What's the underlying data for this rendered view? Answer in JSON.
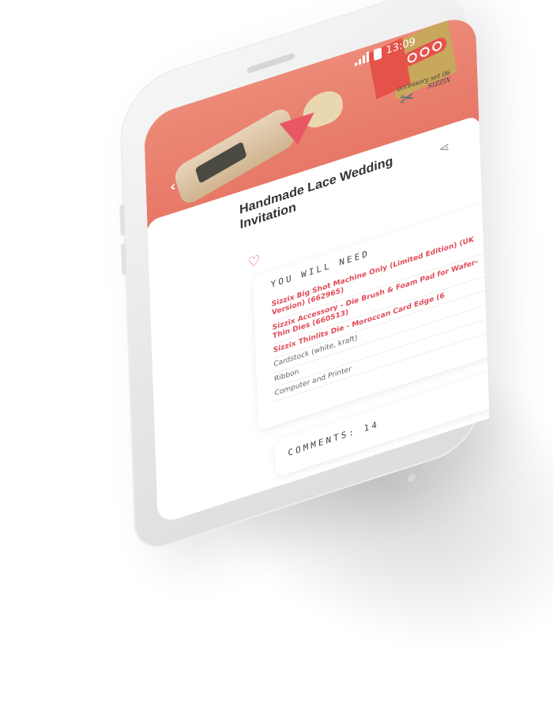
{
  "status_bar": {
    "time": "13:09"
  },
  "hero": {
    "caption_line1": "accessory set 06",
    "caption_line2": "SIZZIX"
  },
  "recipe": {
    "title": "Handmade Lace Wedding Invitation"
  },
  "you_will_need": {
    "heading": "YOU WILL NEED",
    "items": [
      {
        "label": "Sizzix Big Shot Machine Only (Limited Edition) (UK Version) (662965)",
        "type": "link"
      },
      {
        "label": "Sizzix Accessory - Die Brush & Foam Pad for Wafer-Thin Dies (660513)",
        "type": "link"
      },
      {
        "label": "Sizzix Thinlits Die - Moroccan Card Edge (6",
        "type": "link"
      },
      {
        "label": "Cardstock (white, kraft)",
        "type": "plain"
      },
      {
        "label": "Ribbon",
        "type": "plain"
      },
      {
        "label": "Computer and Printer",
        "type": "plain"
      }
    ]
  },
  "comments": {
    "label": "COMMENTS: 14"
  },
  "colors": {
    "hero": "#e77766",
    "accent": "#e14b57",
    "play": "#ea5764"
  },
  "icons": {
    "back": "chevron-left-icon",
    "play": "play-icon",
    "share": "share-icon",
    "heart": "heart-icon",
    "signal": "signal-icon",
    "battery": "battery-icon"
  }
}
